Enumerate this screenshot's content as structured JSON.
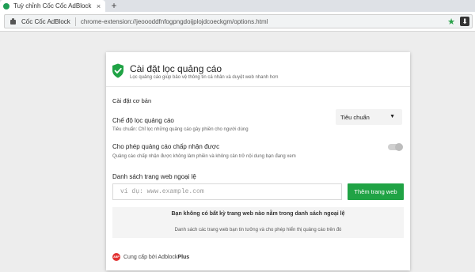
{
  "browser": {
    "tab_title": "Tuỳ chỉnh Cốc Cốc AdBlock",
    "tab_close": "×",
    "new_tab": "+",
    "extension_name": "Cốc Cốc AdBlock",
    "url": "chrome-extension://jeoooddfnfogpngdoijplojdcoeckgm/options.html",
    "star_glyph": "★",
    "download_glyph": "⬇"
  },
  "header": {
    "title": "Cài đặt lọc quảng cáo",
    "subtitle": "Lọc quảng cáo giúp bảo vệ thông tin cá nhân và duyệt web nhanh hơn"
  },
  "settings": {
    "section_title": "Cài đặt cơ bản",
    "filter_mode": {
      "label": "Chế độ lọc quảng cáo",
      "description": "Tiêu chuẩn: Chỉ lọc những quảng cáo gây phiền cho người dùng",
      "selected": "Tiêu chuẩn",
      "caret": "▼"
    },
    "acceptable_ads": {
      "label": "Cho phép quảng cáo chấp nhận được",
      "description": "Quảng cáo chấp nhận được không làm phiền và không cản trở nội dung bạn đang xem",
      "enabled": false
    }
  },
  "exceptions": {
    "label": "Danh sách trang web ngoại lệ",
    "input_placeholder": "ví dụ: www.example.com",
    "add_button": "Thêm trang web",
    "empty_title": "Bạn không có bất kỳ trang web nào nằm trong danh sách ngoại lệ",
    "empty_hint": "Danh sách các trang web bạn tin tưởng và cho phép hiển thị quảng cáo trên đó"
  },
  "footer": {
    "icon_text": "ABP",
    "provided_by": "Cung cấp bởi Adblock",
    "brand_bold": "Plus"
  },
  "colors": {
    "accent_green": "#20a345",
    "abp_red": "#e23131"
  }
}
